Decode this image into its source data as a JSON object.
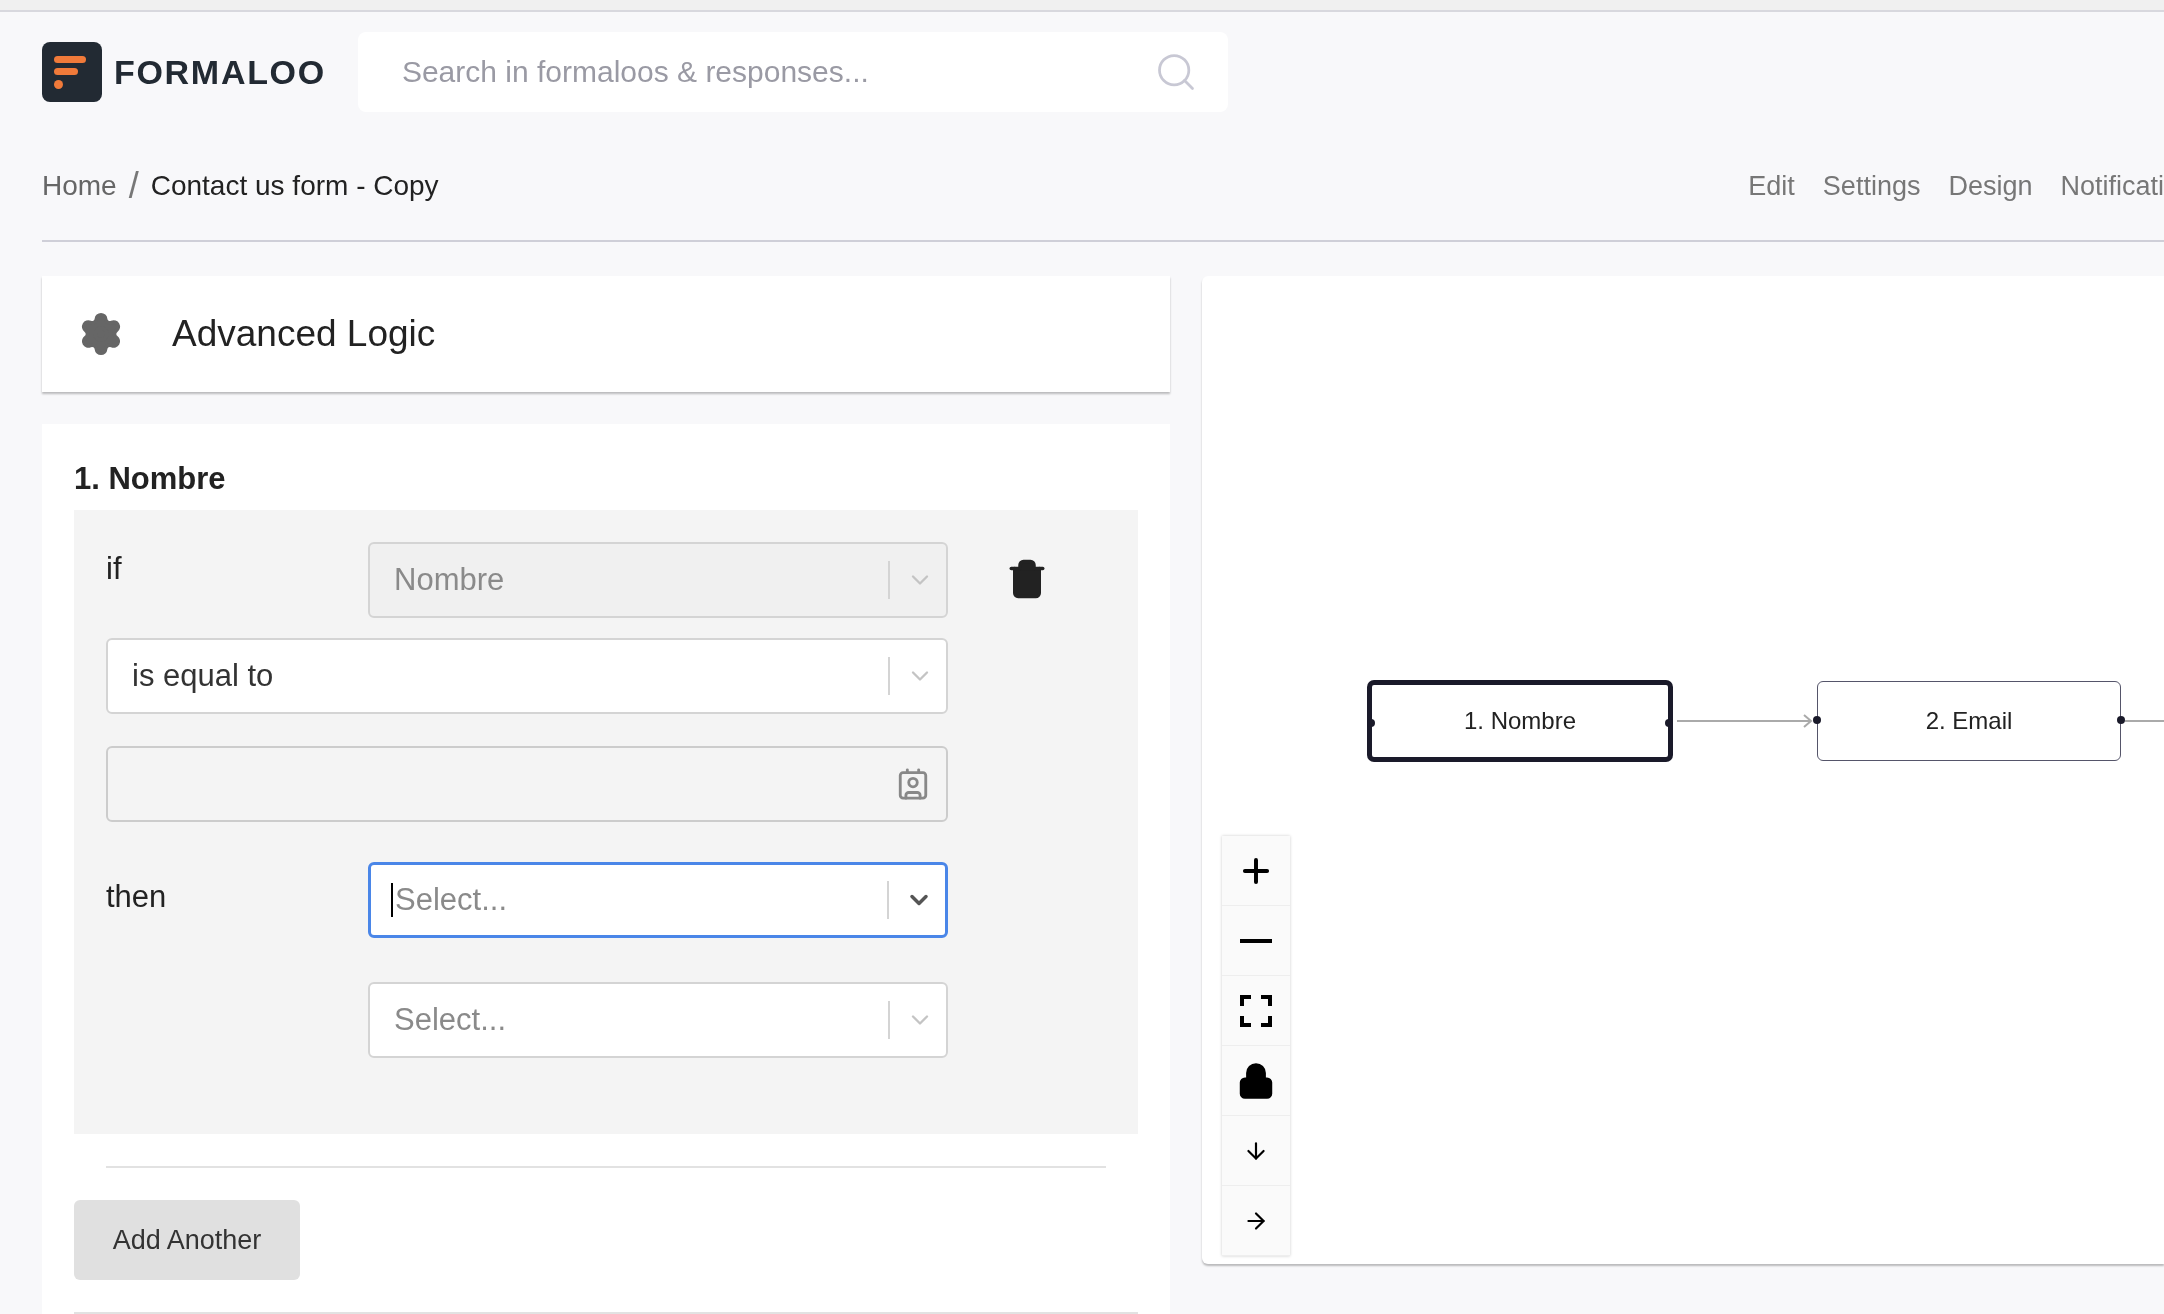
{
  "header": {
    "logo": "FORMALOO",
    "search": {
      "placeholder": "Search in formaloos & responses..."
    }
  },
  "breadcrumb": {
    "items": [
      "Home",
      "Contact us form - Copy"
    ],
    "separator": "/"
  },
  "nav_tabs": [
    "Edit",
    "Settings",
    "Design",
    "Notificati"
  ],
  "panel": {
    "title": "Advanced Logic"
  },
  "rule": {
    "title": "1. Nombre",
    "if_label": "if",
    "field_select": {
      "value": "Nombre",
      "disabled": true
    },
    "operator_select": {
      "value": "is equal to",
      "disabled": false
    },
    "then_label": "then",
    "action_selects": [
      {
        "placeholder": "Select...",
        "focused": true
      },
      {
        "placeholder": "Select...",
        "focused": false
      }
    ],
    "add_button": "Add Another"
  },
  "canvas": {
    "nodes": [
      {
        "label": "1. Nombre",
        "selected": true
      },
      {
        "label": "2. Email",
        "selected": false
      }
    ]
  }
}
